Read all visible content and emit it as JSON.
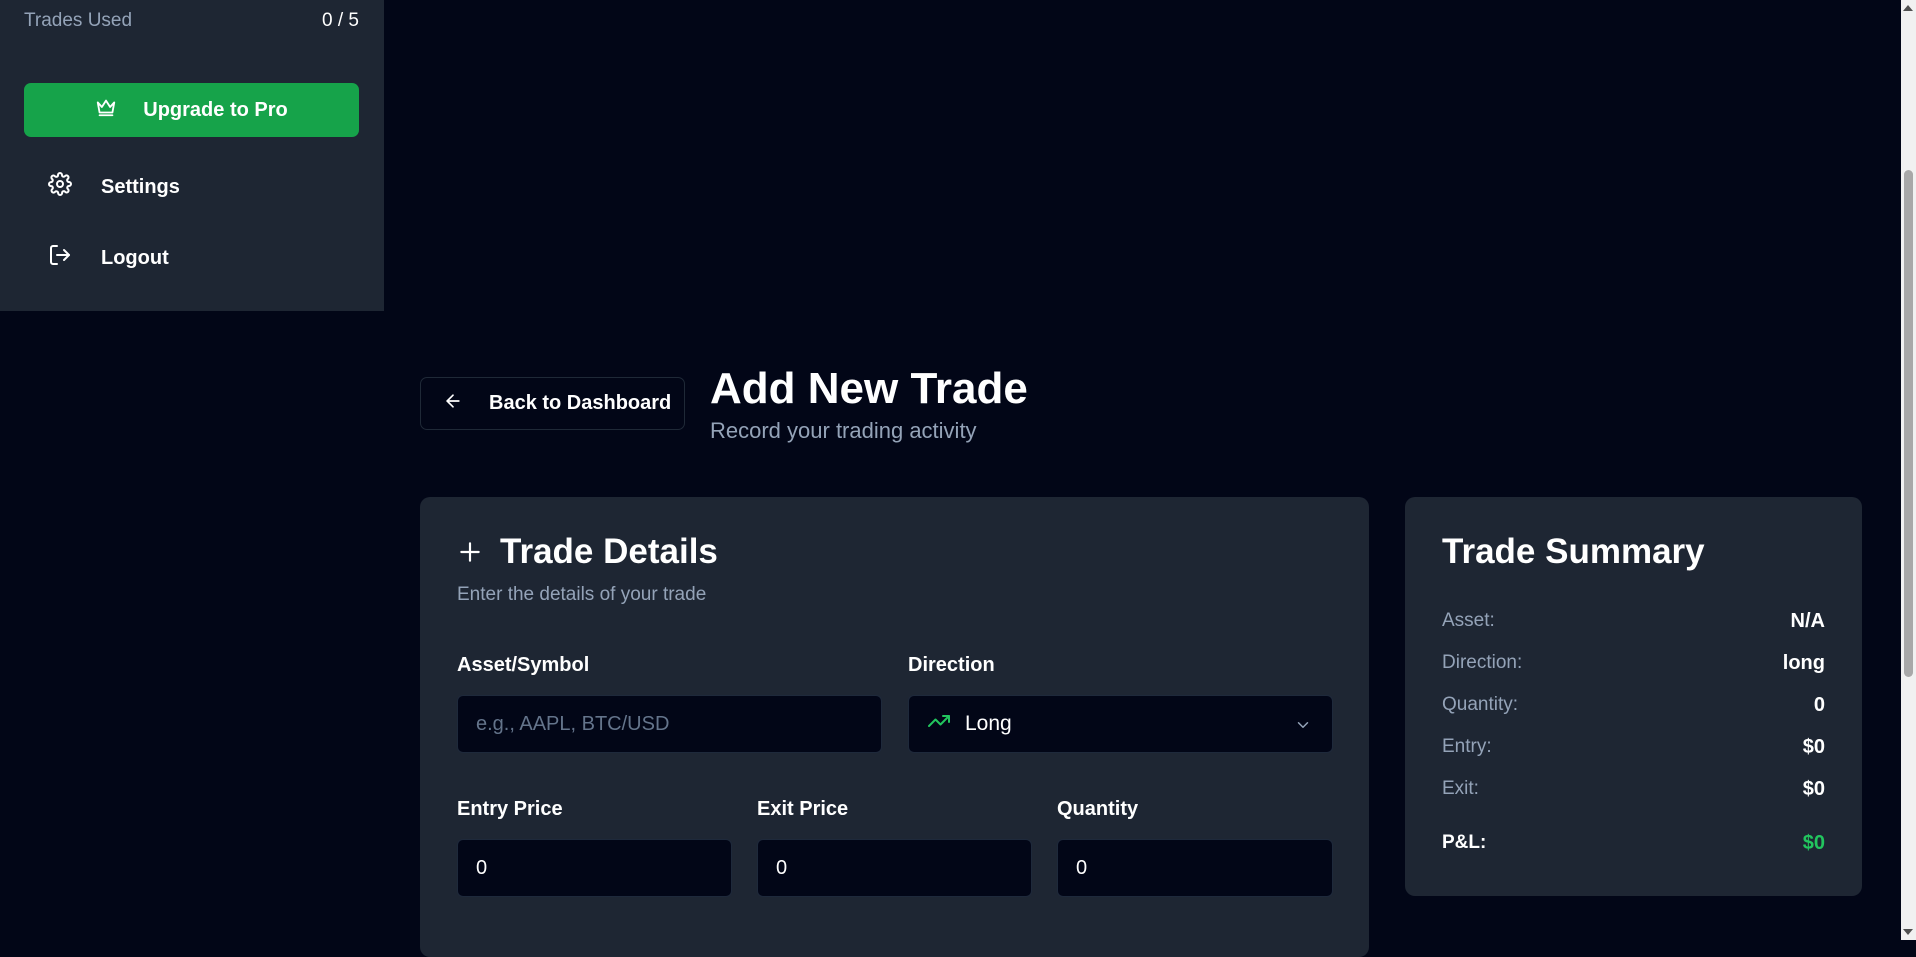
{
  "sidebar": {
    "trades_used_label": "Trades Used",
    "trades_used_count": "0 / 5",
    "upgrade_label": "Upgrade to Pro",
    "settings_label": "Settings",
    "logout_label": "Logout"
  },
  "header": {
    "back_label": "Back to Dashboard",
    "title": "Add New Trade",
    "subtitle": "Record your trading activity"
  },
  "trade_details": {
    "title": "Trade Details",
    "description": "Enter the details of your trade",
    "asset_label": "Asset/Symbol",
    "asset_placeholder": "e.g., AAPL, BTC/USD",
    "direction_label": "Direction",
    "direction_value": "Long",
    "entry_label": "Entry Price",
    "entry_value": "0",
    "exit_label": "Exit Price",
    "exit_value": "0",
    "quantity_label": "Quantity",
    "quantity_value": "0"
  },
  "summary": {
    "title": "Trade Summary",
    "rows": [
      {
        "label": "Asset:",
        "value": "N/A"
      },
      {
        "label": "Direction:",
        "value": "long"
      },
      {
        "label": "Quantity:",
        "value": "0"
      },
      {
        "label": "Entry:",
        "value": "$0"
      },
      {
        "label": "Exit:",
        "value": "$0"
      }
    ],
    "pl_label": "P&L:",
    "pl_value": "$0"
  },
  "icons": {
    "upgrade": "crown-icon",
    "settings": "gear-icon",
    "logout": "logout-icon",
    "back": "arrow-left-icon",
    "details": "plus-icon",
    "direction": "trending-up-icon",
    "select": "chevron-down-icon"
  },
  "colors": {
    "background": "#020617",
    "panel": "#1e2633",
    "accent_green": "#16a34a",
    "profit_green": "#22c55e",
    "muted_text": "#94a3b8"
  }
}
